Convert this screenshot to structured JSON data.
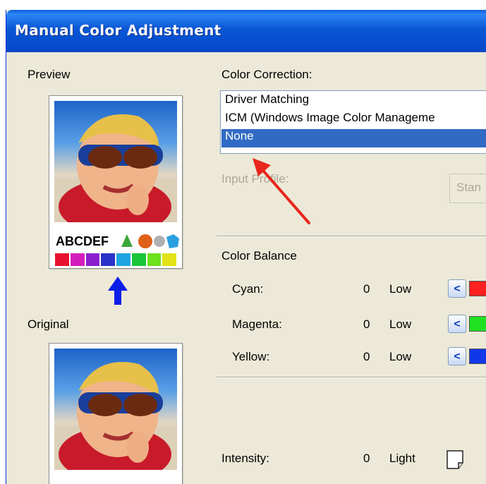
{
  "dialog": {
    "title": "Manual Color Adjustment"
  },
  "left": {
    "preview_label": "Preview",
    "original_label": "Original",
    "thumb_text": "ABCDEF",
    "swatch_colors": [
      "#e8102f",
      "#d41ebc",
      "#8b1fd0",
      "#2a32c8",
      "#1ea5e0",
      "#19c63a",
      "#6ce11c",
      "#e1e316"
    ]
  },
  "color_correction": {
    "label": "Color Correction:",
    "options": [
      {
        "label": "Driver Matching",
        "selected": false
      },
      {
        "label": "ICM (Windows Image Color Manageme",
        "selected": false
      },
      {
        "label": "None",
        "selected": true
      }
    ],
    "input_profile_label": "Input Profile:",
    "input_profile_value": "Stan"
  },
  "color_balance": {
    "label": "Color Balance",
    "rows": [
      {
        "name": "Cyan:",
        "value": "0",
        "level": "Low",
        "bar_color": "#ff2020"
      },
      {
        "name": "Magenta:",
        "value": "0",
        "level": "Low",
        "bar_color": "#1fe11f"
      },
      {
        "name": "Yellow:",
        "value": "0",
        "level": "Low",
        "bar_color": "#1037e8"
      }
    ]
  },
  "intensity": {
    "label": "Intensity:",
    "value": "0",
    "level": "Light"
  },
  "colors": {
    "title_bar": "#0a57d5",
    "selection": "#316ac5",
    "dialog_bg": "#ece9d8",
    "annotation_arrow": "#e8261c"
  }
}
